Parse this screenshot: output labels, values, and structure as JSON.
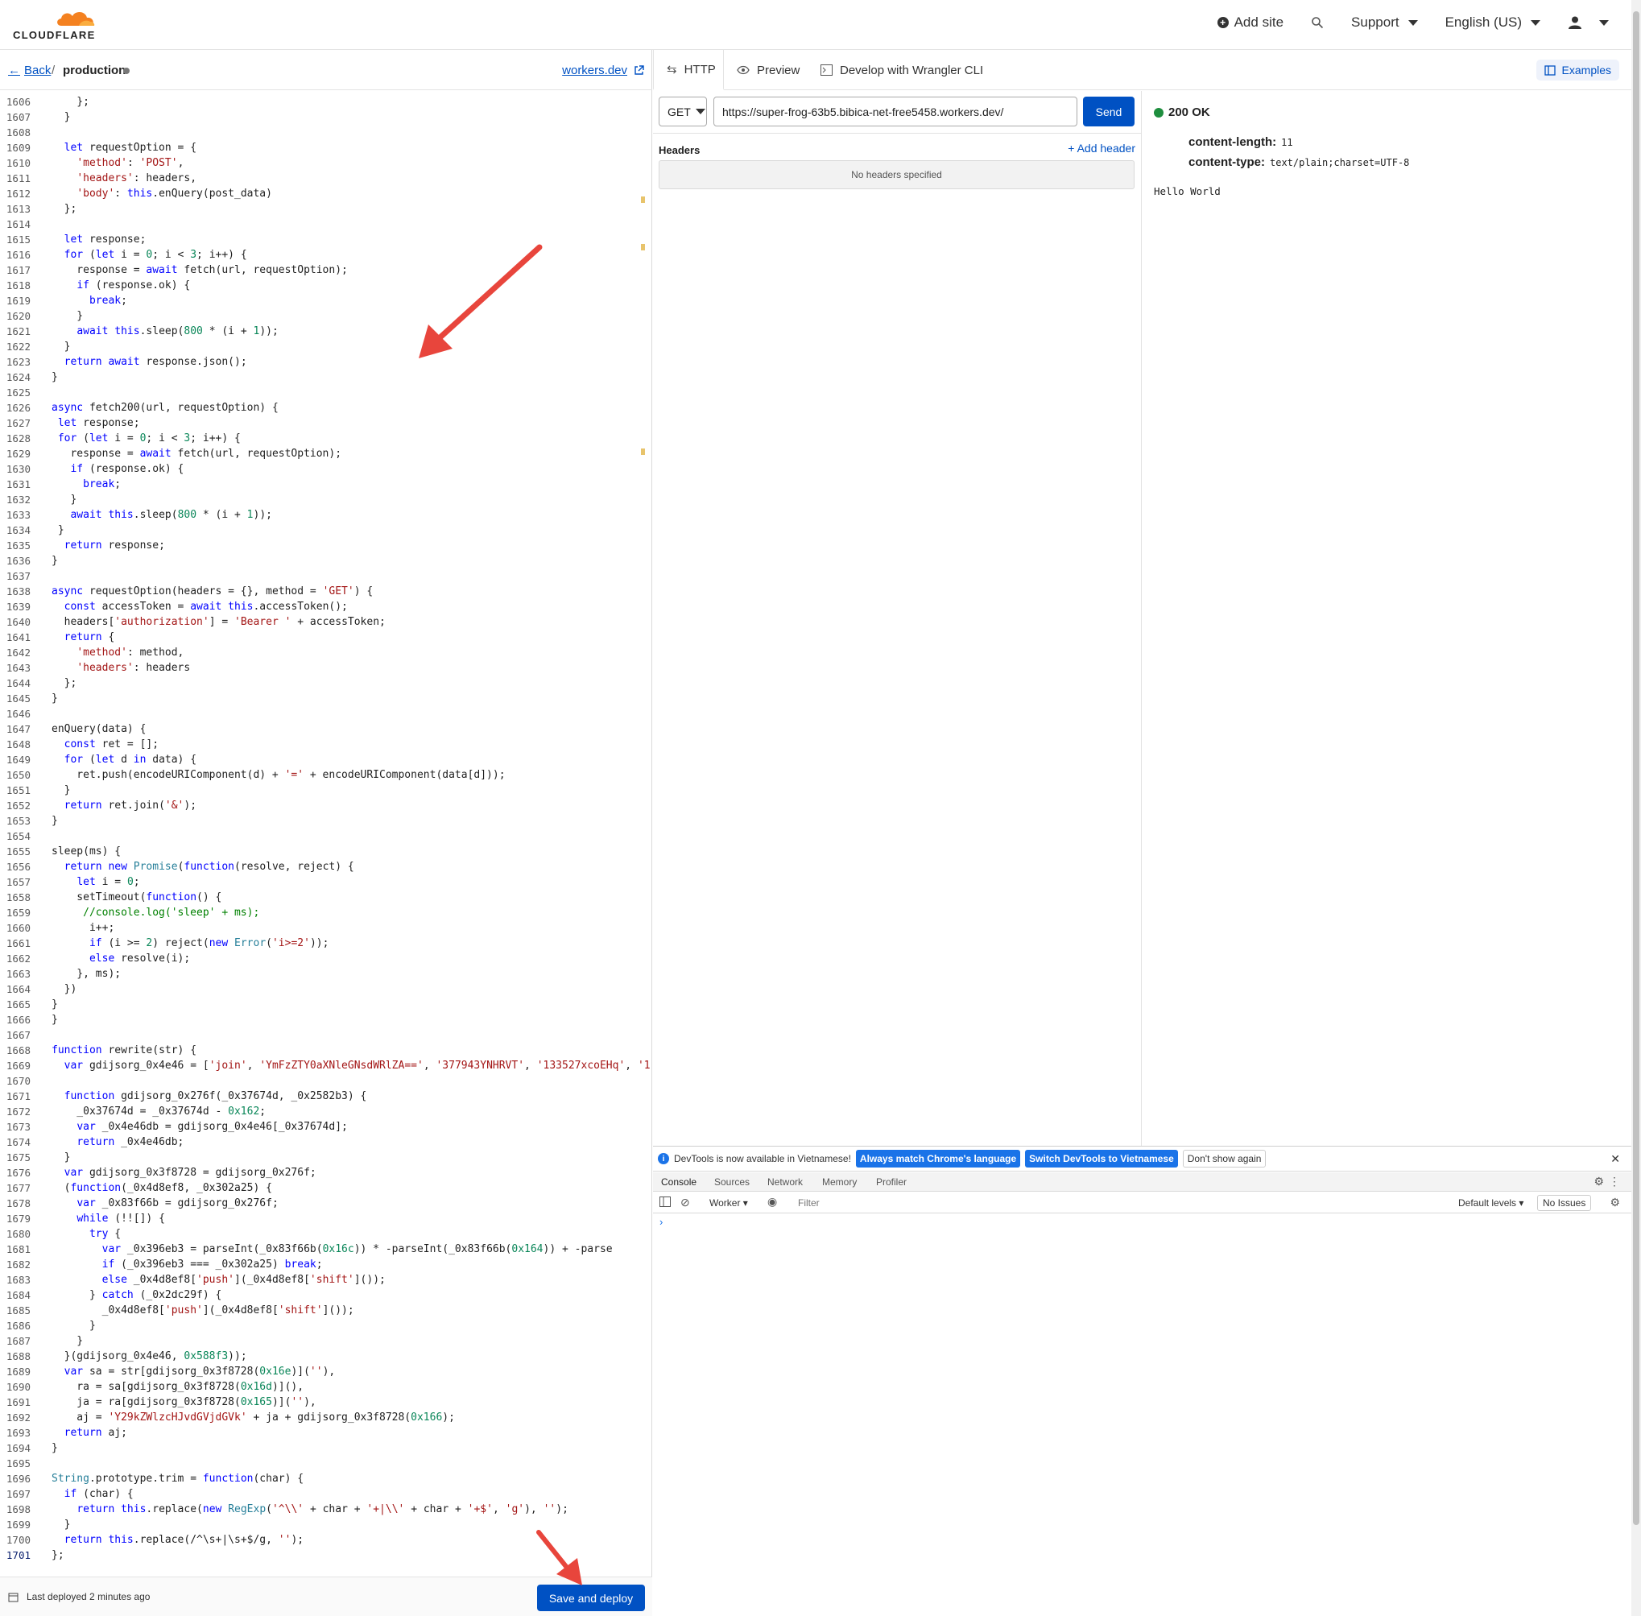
{
  "header": {
    "logo_text": "CLOUDFLARE",
    "add_site": "Add site",
    "support": "Support",
    "language": "English (US)"
  },
  "editor": {
    "back_label": "Back",
    "separator": "/",
    "script_name": "production",
    "workers_dev_link": "workers.dev",
    "last_deployed": "Last deployed 2 minutes ago",
    "save_deploy_label": "Save and deploy",
    "active_line": 1701,
    "lines": [
      {
        "n": 1606,
        "t": "    };"
      },
      {
        "n": 1607,
        "t": "  }"
      },
      {
        "n": 1608,
        "t": ""
      },
      {
        "n": 1609,
        "t": "  let requestOption = {"
      },
      {
        "n": 1610,
        "t": "    'method': 'POST',"
      },
      {
        "n": 1611,
        "t": "    'headers': headers,"
      },
      {
        "n": 1612,
        "t": "    'body': this.enQuery(post_data)"
      },
      {
        "n": 1613,
        "t": "  };"
      },
      {
        "n": 1614,
        "t": ""
      },
      {
        "n": 1615,
        "t": "  let response;"
      },
      {
        "n": 1616,
        "t": "  for (let i = 0; i < 3; i++) {"
      },
      {
        "n": 1617,
        "t": "    response = await fetch(url, requestOption);"
      },
      {
        "n": 1618,
        "t": "    if (response.ok) {"
      },
      {
        "n": 1619,
        "t": "      break;"
      },
      {
        "n": 1620,
        "t": "    }"
      },
      {
        "n": 1621,
        "t": "    await this.sleep(800 * (i + 1));"
      },
      {
        "n": 1622,
        "t": "  }"
      },
      {
        "n": 1623,
        "t": "  return await response.json();"
      },
      {
        "n": 1624,
        "t": "}"
      },
      {
        "n": 1625,
        "t": ""
      },
      {
        "n": 1626,
        "t": "async fetch200(url, requestOption) {"
      },
      {
        "n": 1627,
        "t": " let response;"
      },
      {
        "n": 1628,
        "t": " for (let i = 0; i < 3; i++) {"
      },
      {
        "n": 1629,
        "t": "   response = await fetch(url, requestOption);"
      },
      {
        "n": 1630,
        "t": "   if (response.ok) {"
      },
      {
        "n": 1631,
        "t": "     break;"
      },
      {
        "n": 1632,
        "t": "   }"
      },
      {
        "n": 1633,
        "t": "   await this.sleep(800 * (i + 1));"
      },
      {
        "n": 1634,
        "t": " }"
      },
      {
        "n": 1635,
        "t": "  return response;"
      },
      {
        "n": 1636,
        "t": "}"
      },
      {
        "n": 1637,
        "t": ""
      },
      {
        "n": 1638,
        "t": "async requestOption(headers = {}, method = 'GET') {"
      },
      {
        "n": 1639,
        "t": "  const accessToken = await this.accessToken();"
      },
      {
        "n": 1640,
        "t": "  headers['authorization'] = 'Bearer ' + accessToken;"
      },
      {
        "n": 1641,
        "t": "  return {"
      },
      {
        "n": 1642,
        "t": "    'method': method,"
      },
      {
        "n": 1643,
        "t": "    'headers': headers"
      },
      {
        "n": 1644,
        "t": "  };"
      },
      {
        "n": 1645,
        "t": "}"
      },
      {
        "n": 1646,
        "t": ""
      },
      {
        "n": 1647,
        "t": "enQuery(data) {"
      },
      {
        "n": 1648,
        "t": "  const ret = [];"
      },
      {
        "n": 1649,
        "t": "  for (let d in data) {"
      },
      {
        "n": 1650,
        "t": "    ret.push(encodeURIComponent(d) + '=' + encodeURIComponent(data[d]));"
      },
      {
        "n": 1651,
        "t": "  }"
      },
      {
        "n": 1652,
        "t": "  return ret.join('&');"
      },
      {
        "n": 1653,
        "t": "}"
      },
      {
        "n": 1654,
        "t": ""
      },
      {
        "n": 1655,
        "t": "sleep(ms) {"
      },
      {
        "n": 1656,
        "t": "  return new Promise(function(resolve, reject) {"
      },
      {
        "n": 1657,
        "t": "    let i = 0;"
      },
      {
        "n": 1658,
        "t": "    setTimeout(function() {"
      },
      {
        "n": 1659,
        "t": "     //console.log('sleep' + ms);"
      },
      {
        "n": 1660,
        "t": "      i++;"
      },
      {
        "n": 1661,
        "t": "      if (i >= 2) reject(new Error('i>=2'));"
      },
      {
        "n": 1662,
        "t": "      else resolve(i);"
      },
      {
        "n": 1663,
        "t": "    }, ms);"
      },
      {
        "n": 1664,
        "t": "  })"
      },
      {
        "n": 1665,
        "t": "}"
      },
      {
        "n": 1666,
        "t": "}"
      },
      {
        "n": 1667,
        "t": ""
      },
      {
        "n": 1668,
        "t": "function rewrite(str) {"
      },
      {
        "n": 1669,
        "t": "  var gdijsorg_0x4e46 = ['join', 'YmFzZTY0aXNleGNsdWRlZA==', '377943YNHRVT', '133527xcoEHq', '1"
      },
      {
        "n": 1670,
        "t": ""
      },
      {
        "n": 1671,
        "t": "  function gdijsorg_0x276f(_0x37674d, _0x2582b3) {"
      },
      {
        "n": 1672,
        "t": "    _0x37674d = _0x37674d - 0x162;"
      },
      {
        "n": 1673,
        "t": "    var _0x4e46db = gdijsorg_0x4e46[_0x37674d];"
      },
      {
        "n": 1674,
        "t": "    return _0x4e46db;"
      },
      {
        "n": 1675,
        "t": "  }"
      },
      {
        "n": 1676,
        "t": "  var gdijsorg_0x3f8728 = gdijsorg_0x276f;"
      },
      {
        "n": 1677,
        "t": "  (function(_0x4d8ef8, _0x302a25) {"
      },
      {
        "n": 1678,
        "t": "    var _0x83f66b = gdijsorg_0x276f;"
      },
      {
        "n": 1679,
        "t": "    while (!![]) {"
      },
      {
        "n": 1680,
        "t": "      try {"
      },
      {
        "n": 1681,
        "t": "        var _0x396eb3 = parseInt(_0x83f66b(0x16c)) * -parseInt(_0x83f66b(0x164)) + -parse"
      },
      {
        "n": 1682,
        "t": "        if (_0x396eb3 === _0x302a25) break;"
      },
      {
        "n": 1683,
        "t": "        else _0x4d8ef8['push'](_0x4d8ef8['shift']());"
      },
      {
        "n": 1684,
        "t": "      } catch (_0x2dc29f) {"
      },
      {
        "n": 1685,
        "t": "        _0x4d8ef8['push'](_0x4d8ef8['shift']());"
      },
      {
        "n": 1686,
        "t": "      }"
      },
      {
        "n": 1687,
        "t": "    }"
      },
      {
        "n": 1688,
        "t": "  }(gdijsorg_0x4e46, 0x588f3));"
      },
      {
        "n": 1689,
        "t": "  var sa = str[gdijsorg_0x3f8728(0x16e)](''),"
      },
      {
        "n": 1690,
        "t": "    ra = sa[gdijsorg_0x3f8728(0x16d)](),"
      },
      {
        "n": 1691,
        "t": "    ja = ra[gdijsorg_0x3f8728(0x165)](''),"
      },
      {
        "n": 1692,
        "t": "    aj = 'Y29kZWlzcHJvdGVjdGVk' + ja + gdijsorg_0x3f8728(0x166);"
      },
      {
        "n": 1693,
        "t": "  return aj;"
      },
      {
        "n": 1694,
        "t": "}"
      },
      {
        "n": 1695,
        "t": ""
      },
      {
        "n": 1696,
        "t": "String.prototype.trim = function(char) {"
      },
      {
        "n": 1697,
        "t": "  if (char) {"
      },
      {
        "n": 1698,
        "t": "    return this.replace(new RegExp('^\\\\' + char + '+|\\\\' + char + '+$', 'g'), '');"
      },
      {
        "n": 1699,
        "t": "  }"
      },
      {
        "n": 1700,
        "t": "  return this.replace(/^\\s+|\\s+$/g, '');"
      },
      {
        "n": 1701,
        "t": "};"
      }
    ]
  },
  "tabs": {
    "http": "HTTP",
    "preview": "Preview",
    "wrangler": "Develop with Wrangler CLI",
    "examples": "Examples"
  },
  "request": {
    "method": "GET",
    "url": "https://super-frog-63b5.bibica-net-free5458.workers.dev/",
    "send_label": "Send",
    "headers_title": "Headers",
    "add_header": "Add header",
    "no_headers": "No headers specified"
  },
  "response": {
    "status": "200 OK",
    "status_color": "#1e8e3e",
    "headers": [
      {
        "name": "content-length:",
        "value": "11"
      },
      {
        "name": "content-type:",
        "value": "text/plain;charset=UTF-8"
      }
    ],
    "body": "Hello World"
  },
  "devtools": {
    "notice": "DevTools is now available in Vietnamese!",
    "btn_match": "Always match Chrome's language",
    "btn_switch": "Switch DevTools to Vietnamese",
    "btn_dont_show": "Don't show again",
    "tabs": [
      "Console",
      "Sources",
      "Network",
      "Memory",
      "Profiler"
    ],
    "context": "Worker",
    "filter_placeholder": "Filter",
    "levels": "Default levels",
    "issues": "No Issues",
    "prompt": "›"
  },
  "colors": {
    "accent": "#0051c3",
    "devtools_blue": "#1a73e8",
    "arrow": "#e8453c"
  }
}
